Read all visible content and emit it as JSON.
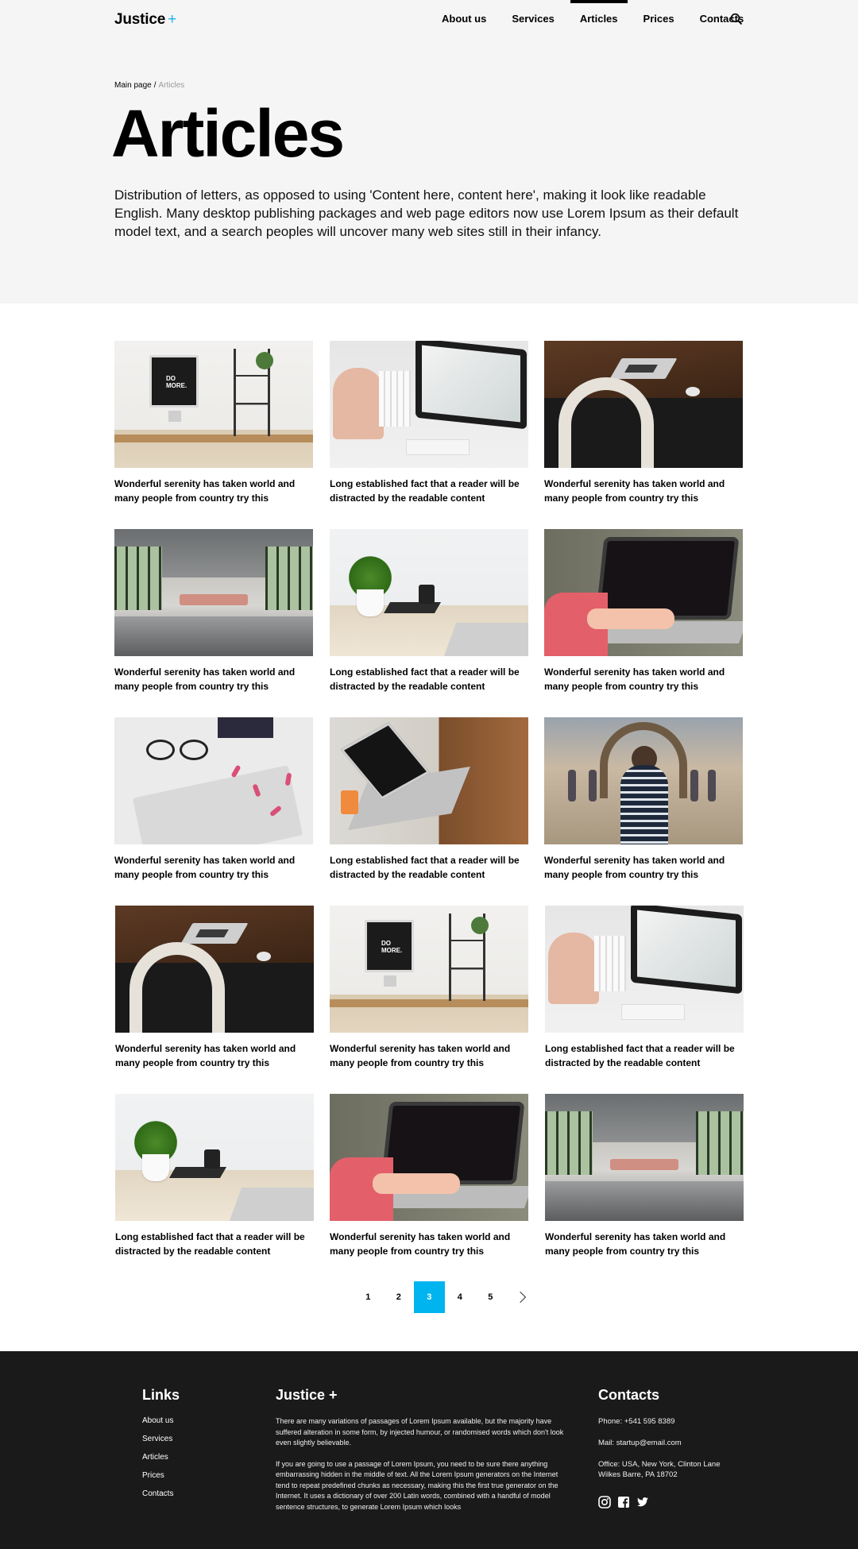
{
  "header": {
    "logo_text": "Justice",
    "logo_plus": "+",
    "nav": [
      "About us",
      "Services",
      "Articles",
      "Prices",
      "Contacts"
    ],
    "active_nav": "Articles",
    "search_icon": "search-icon"
  },
  "breadcrumb": {
    "home": "Main page",
    "separator": "/",
    "current": "Articles"
  },
  "hero": {
    "title": "Articles",
    "intro": "Distribution of letters, as opposed to using 'Content here, content here', making it look like readable English. Many desktop publishing packages and web page editors now use Lorem Ipsum as their default model text, and a search peoples will uncover many web sites still in their infancy."
  },
  "articles": [
    {
      "title": "Wonderful serenity has taken world and many people from country try this",
      "image": "desk-imac"
    },
    {
      "title": "Long established fact that a reader will be distracted by the readable content",
      "image": "imac-bag"
    },
    {
      "title": "Wonderful serenity has taken world and many people from country try this",
      "image": "laptop-chair"
    },
    {
      "title": "Wonderful serenity has taken world and many people from country try this",
      "image": "office"
    },
    {
      "title": "Long established fact that a reader will be distracted by the readable content",
      "image": "plant"
    },
    {
      "title": "Wonderful serenity has taken world and many people from country try this",
      "image": "typing"
    },
    {
      "title": "Wonderful serenity has taken world and many people from country try this",
      "image": "glasses"
    },
    {
      "title": "Long established fact that a reader will be distracted by the readable content",
      "image": "macbook-hands"
    },
    {
      "title": "Wonderful serenity has taken world and many people from country try this",
      "image": "street"
    },
    {
      "title": "Wonderful serenity has taken world and many people from country try this",
      "image": "laptop-chair"
    },
    {
      "title": "Wonderful serenity has taken world and many people from country try this",
      "image": "desk-imac"
    },
    {
      "title": "Long established fact that a reader will be distracted by the readable content",
      "image": "imac-bag"
    },
    {
      "title": "Long established fact that a reader will be distracted by the readable content",
      "image": "plant"
    },
    {
      "title": "Wonderful serenity has taken world and many people from country try this",
      "image": "typing"
    },
    {
      "title": "Wonderful serenity has taken world and many people from country try this",
      "image": "office"
    }
  ],
  "pagination": {
    "pages": [
      "1",
      "2",
      "3",
      "4",
      "5"
    ],
    "current": "3",
    "next_icon": "chevron-right-icon"
  },
  "footer": {
    "links_heading": "Links",
    "links": [
      "About us",
      "Services",
      "Articles",
      "Prices",
      "Contacts"
    ],
    "about_heading": "Justice +",
    "about_p1": "There are many variations of passages of Lorem Ipsum available, but the majority have suffered alteration in some form, by injected humour, or randomised words which don't look even slightly believable.",
    "about_p2": "If you are going to use a passage of Lorem Ipsum, you need to be sure there anything embarrassing hidden in the middle of text. All the Lorem Ipsum generators on the Internet tend to repeat predefined chunks as necessary, making this the first true generator on the Internet. It uses a dictionary of over 200 Latin words, combined with a handful of model sentence structures, to generate Lorem Ipsum which looks",
    "contacts_heading": "Contacts",
    "phone": "Phone: +541 595 8389",
    "mail": "Mail: startup@email.com",
    "office": "Office: USA, New York, Clinton Lane Wilkes Barre, PA 18702",
    "social": [
      "instagram-icon",
      "facebook-icon",
      "twitter-icon"
    ]
  },
  "colors": {
    "accent": "#00b4ef",
    "hero_bg": "#f5f5f5",
    "footer_bg": "#1a1a1a"
  }
}
